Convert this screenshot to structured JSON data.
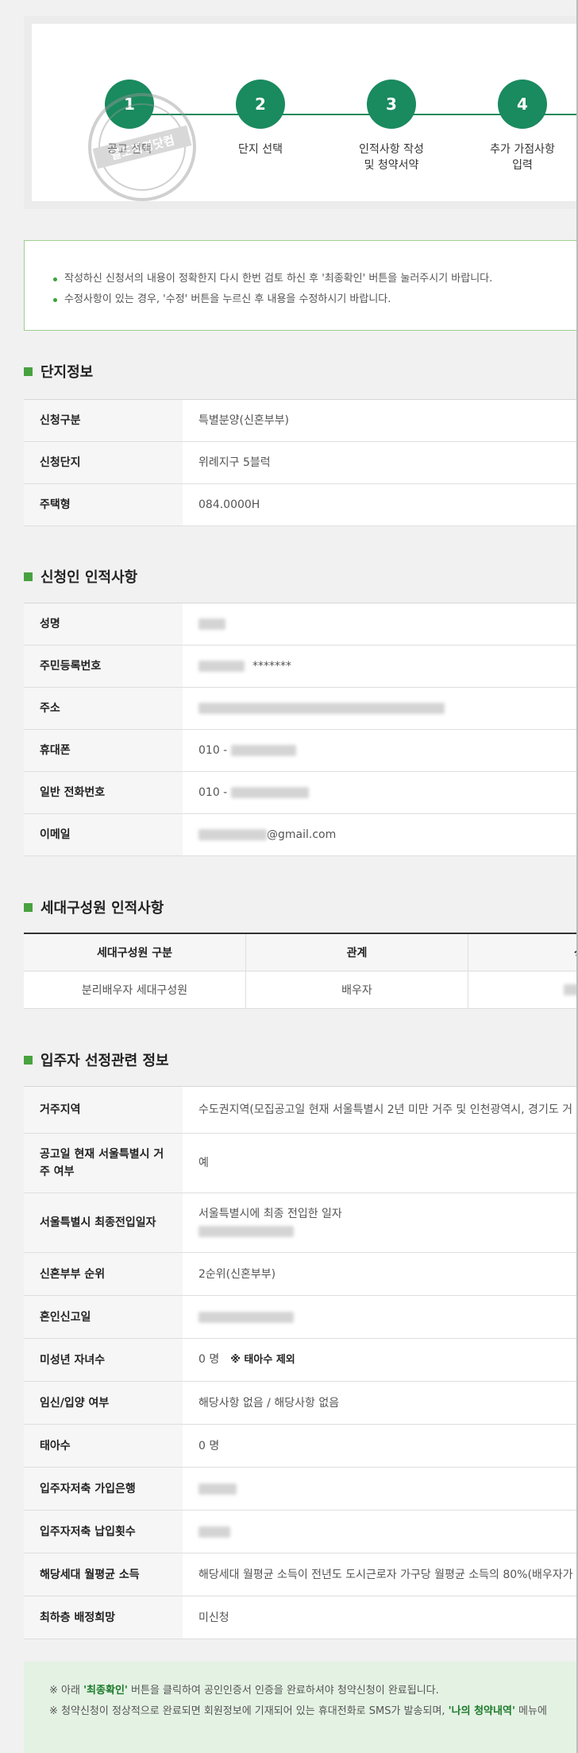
{
  "steps": [
    {
      "num": "1",
      "label": "공고 선택"
    },
    {
      "num": "2",
      "label": "단지 선택"
    },
    {
      "num": "3",
      "label": "인적사항 작성\n및 청약서약"
    },
    {
      "num": "4",
      "label": "추가 가점사항\n입력"
    }
  ],
  "stamp_text": "열도리경닷컴",
  "notice": [
    "작성하신 신청서의 내용이 정확한지 다시 한번 검토 하신 후 '최종확인' 버튼을 눌러주시기 바랍니다.",
    "수정사항이 있는 경우, '수정' 버튼을 누르신 후 내용을 수정하시기 바랍니다."
  ],
  "complex_info": {
    "title": "단지정보",
    "rows": [
      {
        "label": "신청구분",
        "value": "특별분양(신혼부부)"
      },
      {
        "label": "신청단지",
        "value": "위례지구 5블럭"
      },
      {
        "label": "주택형",
        "value": "084.0000H"
      }
    ]
  },
  "applicant": {
    "title": "신청인 인적사항",
    "rows": [
      {
        "label": "성명",
        "value": ""
      },
      {
        "label": "주민등록번호",
        "value": "*******"
      },
      {
        "label": "주소",
        "value": ""
      },
      {
        "label": "휴대폰",
        "value": "010 -"
      },
      {
        "label": "일반 전화번호",
        "value": "010 -"
      },
      {
        "label": "이메일",
        "value": "@gmail.com"
      }
    ]
  },
  "household": {
    "title": "세대구성원 인적사항",
    "headers": [
      "세대구성원 구분",
      "관계",
      "성"
    ],
    "rows": [
      [
        "분리배우자 세대구성원",
        "배우자",
        ""
      ]
    ]
  },
  "selection": {
    "title": "입주자 선정관련 정보",
    "rows": [
      {
        "label": "거주지역",
        "value": "수도권지역(모집공고일 현재 서울특별시 2년 미만 거주 및 인천광역시, 경기도 거"
      },
      {
        "label": "공고일 현재 서울특별시 거주 여부",
        "value": "예"
      },
      {
        "label": "서울특별시 최종전입일자",
        "value": "서울특별시에 최종 전입한 일자"
      },
      {
        "label": "신혼부부 순위",
        "value": "2순위(신혼부부)"
      },
      {
        "label": "혼인신고일",
        "value": ""
      },
      {
        "label": "미성년 자녀수",
        "value": "0 명",
        "note": "※ 태아수 제외"
      },
      {
        "label": "임신/입양 여부",
        "value": "해당사항 없음 / 해당사항 없음"
      },
      {
        "label": "태아수",
        "value": "0 명"
      },
      {
        "label": "입주자저축 가입은행",
        "value": ""
      },
      {
        "label": "입주자저축 납입횟수",
        "value": ""
      },
      {
        "label": "해당세대 월평균 소득",
        "value": "해당세대 월평균 소득이 전년도 도시근로자 가구당 월평균 소득의 80%(배우자가"
      },
      {
        "label": "최하층 배정희망",
        "value": "미신청"
      }
    ]
  },
  "bottom": {
    "line1_pre": "※ 아래 ",
    "line1_hl": "'최종확인'",
    "line1_post": " 버튼을 클릭하여 공인인증서 인증을 완료하셔야 청약신청이 완료됩니다.",
    "line2_pre": "※ 청약신청이 정상적으로 완료되면 회원정보에 기재되어 있는 휴대전화로 SMS가 발송되며, ",
    "line2_hl": "'나의 청약내역'",
    "line2_post": " 메뉴에"
  },
  "colors": {
    "accent": "#1a8a5f",
    "section_mark": "#48a23f",
    "notice_border": "#9fd08f"
  }
}
